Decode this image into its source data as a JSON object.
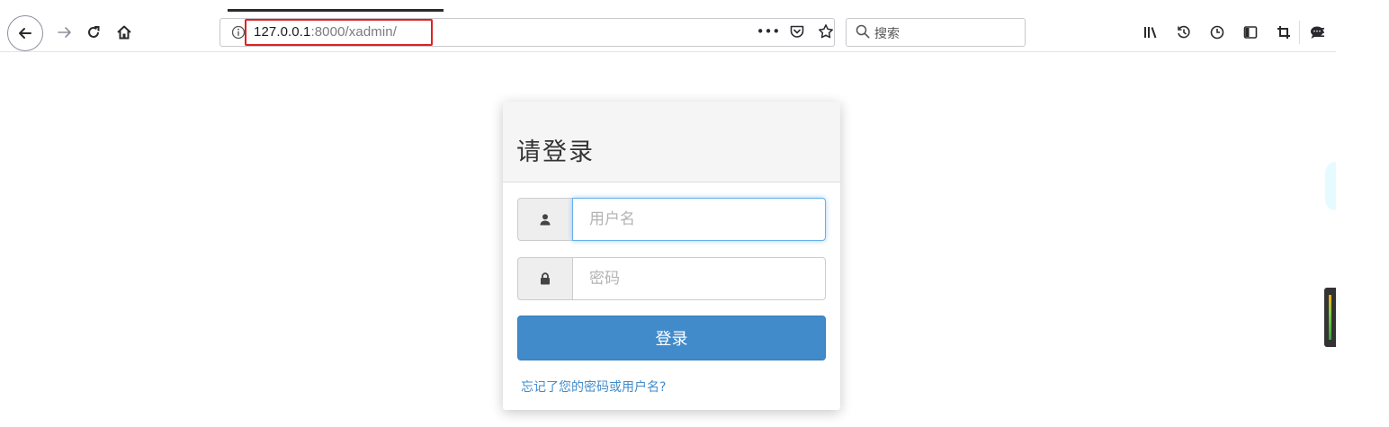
{
  "browser": {
    "url_host": "127.0.0.1",
    "url_path": ":8000/xadmin/",
    "search_placeholder": "搜索",
    "more_actions": "•••"
  },
  "login": {
    "title": "请登录",
    "username_placeholder": "用户名",
    "password_placeholder": "密码",
    "submit_label": "登录",
    "forgot_link": "忘记了您的密码或用户名?"
  },
  "colors": {
    "primary": "#428bca",
    "highlight_border": "#e02020",
    "focus_border": "#66afe9"
  }
}
